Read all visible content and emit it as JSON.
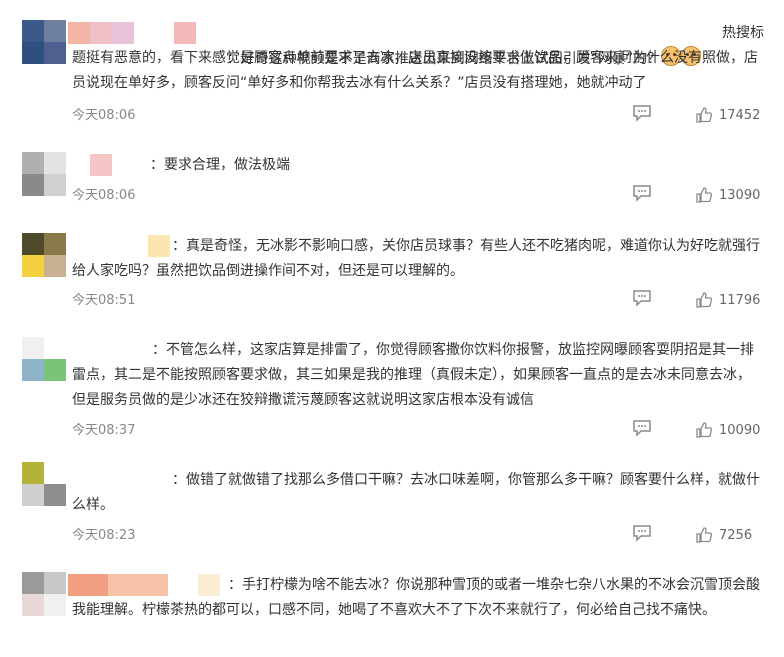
{
  "comments": [
    {
      "text": "：好奇这种视频是不是商家推送出来到网络平台上试图引发“网暴”的？",
      "text_tail": "热搜标题挺有恶意的，看下来感觉是顾客点单前要求了去冰，店员直接没按要求做饮品，顾客来问为什么没有照做，店员说现在单好多，顾客反问“单好多和你帮我去冰有什么关系？”店员没有搭理她，她就冲动了",
      "emoji_icons": [
        "cat-emoji-icon",
        "cat-emoji-icon"
      ],
      "time": "今天08:06",
      "likes": "17452",
      "avatar_colors": [
        "#3a5a8a",
        "#6f7fa0",
        "#2f4f80",
        "#4f5f90"
      ],
      "nick_colors": [
        "#f3b6a6",
        "#f0c0c8",
        "#e9c3d8",
        "#ffffff",
        "#f2b8b8"
      ]
    },
    {
      "text": "：要求合理，做法极端",
      "time": "今天08:06",
      "likes": "13090",
      "avatar_colors": [
        "#b0b0b0",
        "#e3e3e3",
        "#8a8a8a",
        "#d0d0d0"
      ],
      "nick_colors": [
        "#ffffff",
        "#f4c6c6"
      ]
    },
    {
      "text": "：真是奇怪，无冰影不影响口感，关你店员球事？有些人还不吃猪肉呢，难道你认为好吃就强行给人家吃吗？虽然把饮品倒进操作间不对，但还是可以理解的。",
      "time": "今天08:51",
      "likes": "11796",
      "avatar_colors": [
        "#4f4a2a",
        "#8a7a4a",
        "#f5d040",
        "#c9b090"
      ],
      "nick_colors": [
        "#ffffff",
        "#fbe6b0"
      ]
    },
    {
      "text": "：不管怎么样，这家店算是排雷了，你觉得顾客撒你饮料你报警，放监控网曝顾客耍阴招是其一排雷点，其二是不能按照顾客要求做，其三如果是我的推理（真假未定），如果顾客一直点的是去冰未同意去冰，但是服务员做的是少冰还在狡辩撒谎污蔑顾客这就说明这家店根本没有诚信",
      "time": "今天08:37",
      "likes": "10090",
      "avatar_colors": [
        "#f0f0f0",
        "#ffffff",
        "#8fb3c8",
        "#7ac47a"
      ],
      "nick_colors": [
        "#ffffff"
      ]
    },
    {
      "text": "：做错了就做错了找那么多借口干嘛？去冰口味差啊，你管那么多干嘛？顾客要什么样，就做什么样。",
      "time": "今天08:23",
      "likes": "7256",
      "avatar_colors": [
        "#b5b23a",
        "#ffffff",
        "#cfcfcf",
        "#8e8e8e"
      ],
      "nick_colors": [
        "#ffffff"
      ]
    },
    {
      "text": "：手打柠檬为啥不能去冰？你说那种雪顶的或者一堆杂七杂八水果的不冰会沉雪顶会酸我能理解。柠檬茶热的都可以，口感不同，她喝了不喜欢大不了下次不来就行了，何必给自己找不痛快。",
      "time": "",
      "likes": "",
      "avatar_colors": [
        "#9a9a9a",
        "#c8c8c8",
        "#e8d8d8",
        "#f0f0f0"
      ],
      "nick_colors": [
        "#f0a080",
        "#f6c2a8",
        "#ffffff",
        "#fbecd4"
      ]
    }
  ],
  "icons": {
    "reply": "comment-bubble-icon",
    "like": "thumbs-up-icon"
  }
}
